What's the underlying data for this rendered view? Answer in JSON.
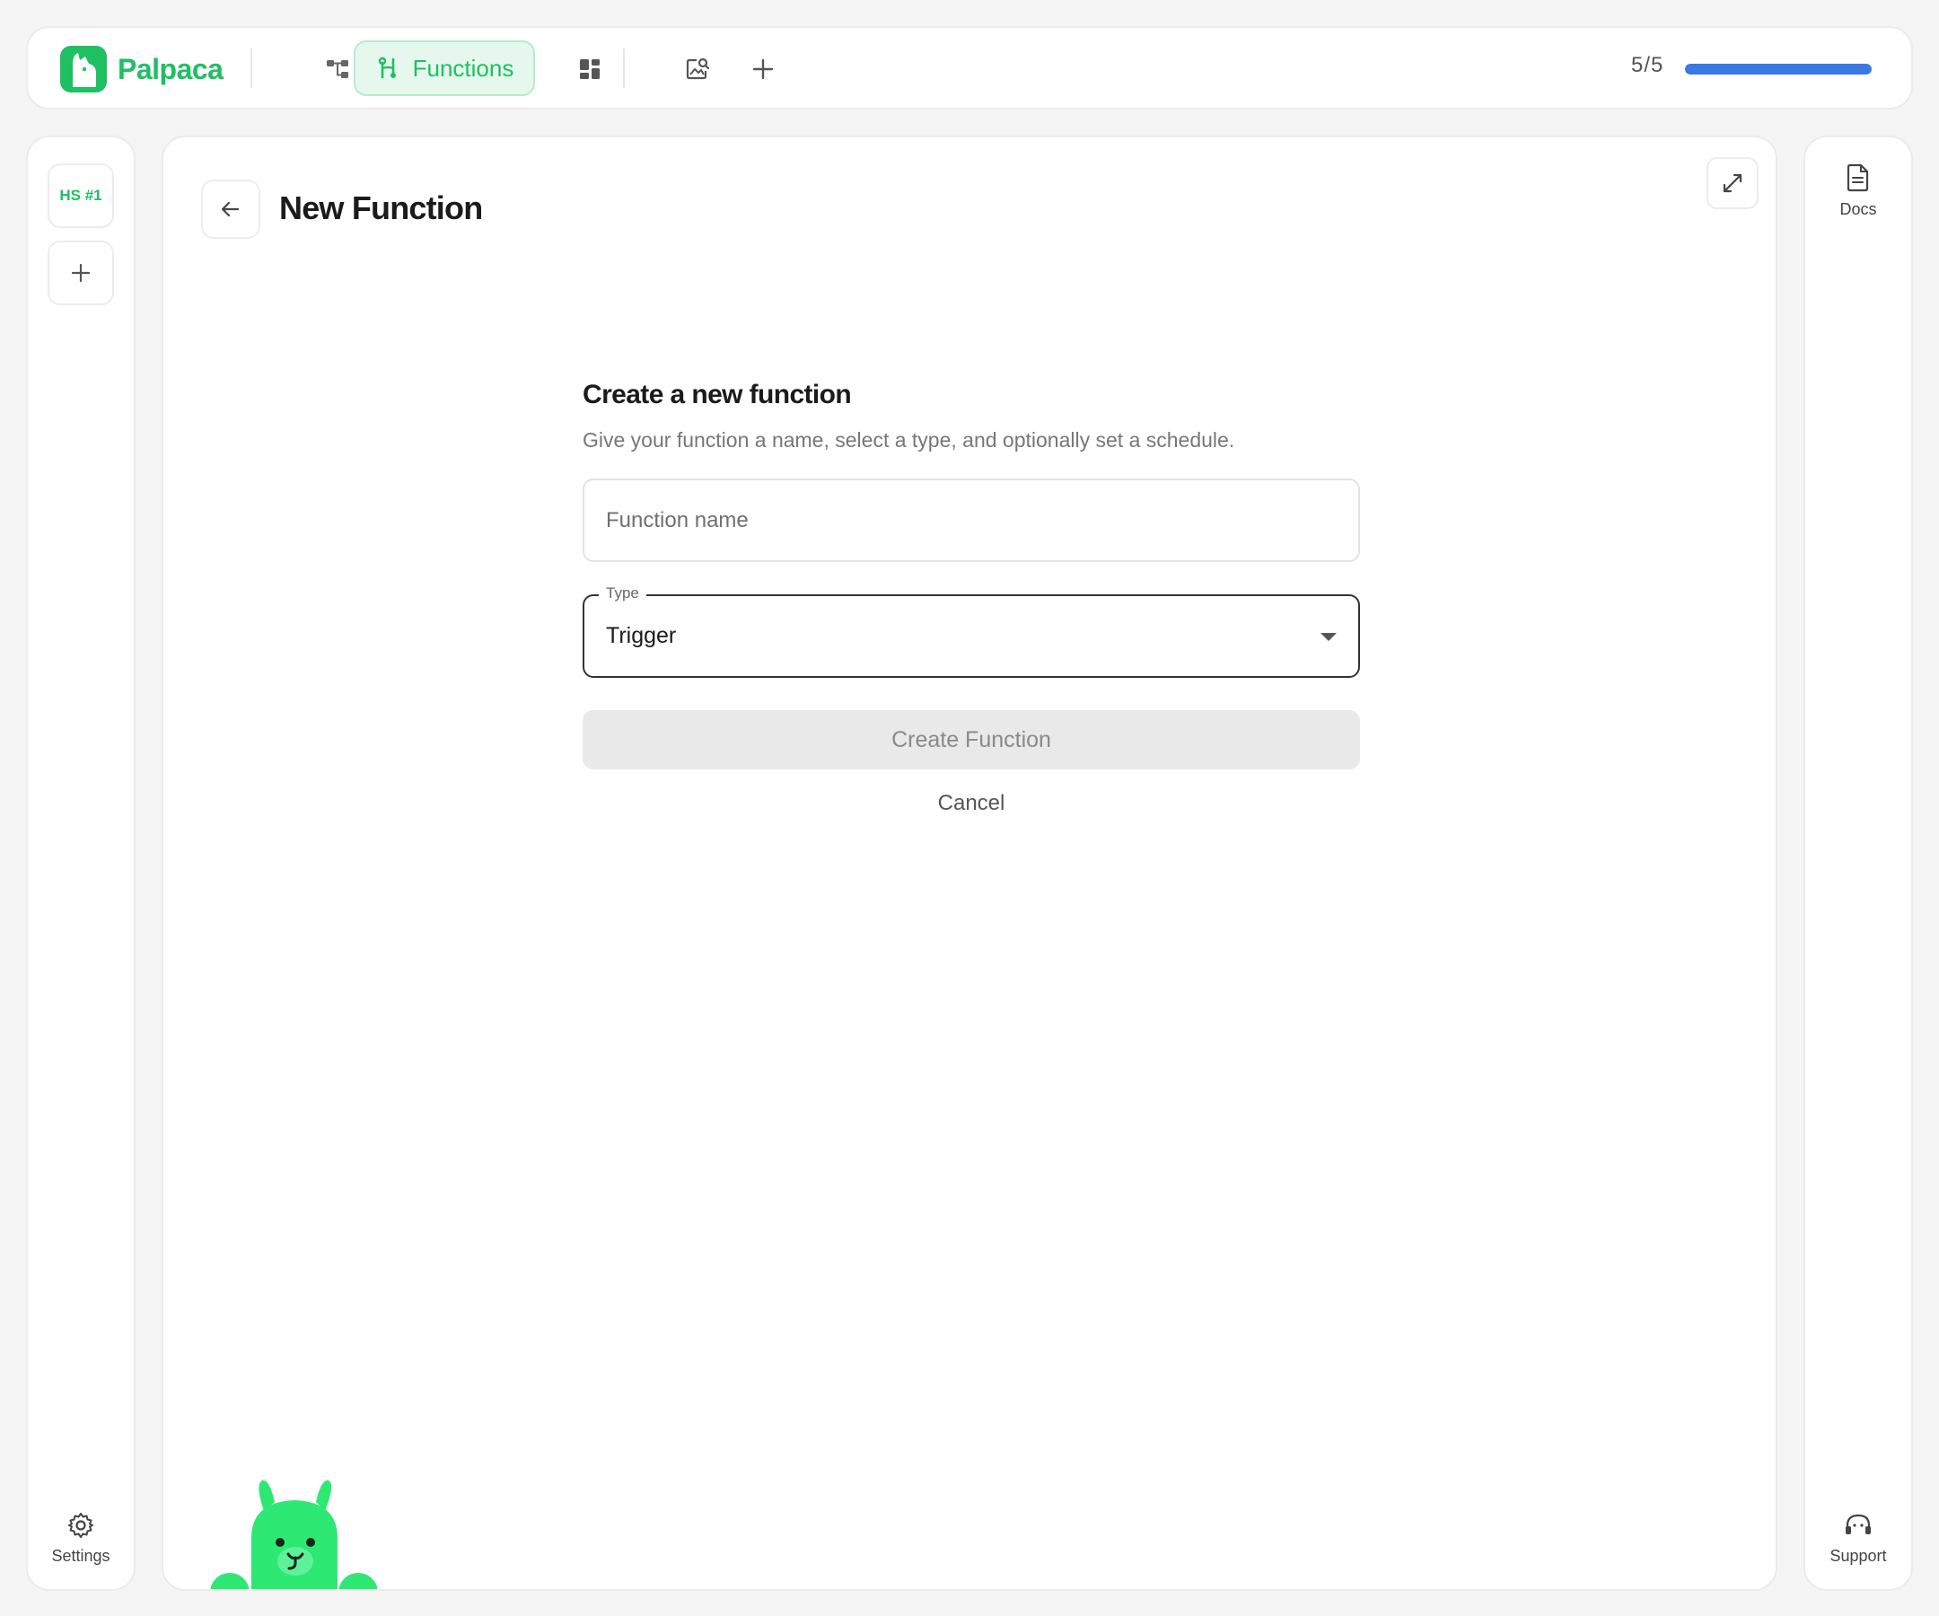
{
  "app": {
    "name": "Palpaca"
  },
  "topbar": {
    "nav": [
      {
        "icon": "workflow-icon"
      },
      {
        "icon": "functions-icon",
        "label": "Functions",
        "active": true
      },
      {
        "icon": "dashboard-icon"
      },
      {
        "icon": "image-search-icon"
      },
      {
        "icon": "plus-icon"
      }
    ],
    "progress": {
      "text": "5/5",
      "fraction": 1.0
    }
  },
  "left_rail": {
    "project_badge": "HS #1",
    "settings_label": "Settings"
  },
  "right_rail": {
    "docs_label": "Docs",
    "support_label": "Support"
  },
  "main": {
    "title": "New Function",
    "form": {
      "heading": "Create a new function",
      "description": "Give your function a name, select a type, and optionally set a schedule.",
      "name_placeholder": "Function name",
      "name_value": "",
      "type_label": "Type",
      "type_value": "Trigger",
      "submit_label": "Create Function",
      "cancel_label": "Cancel"
    }
  },
  "colors": {
    "brand_green": "#1fbf63",
    "mascot_green": "#2ee874",
    "progress_blue": "#3978e6",
    "background": "#f5f5f5"
  }
}
